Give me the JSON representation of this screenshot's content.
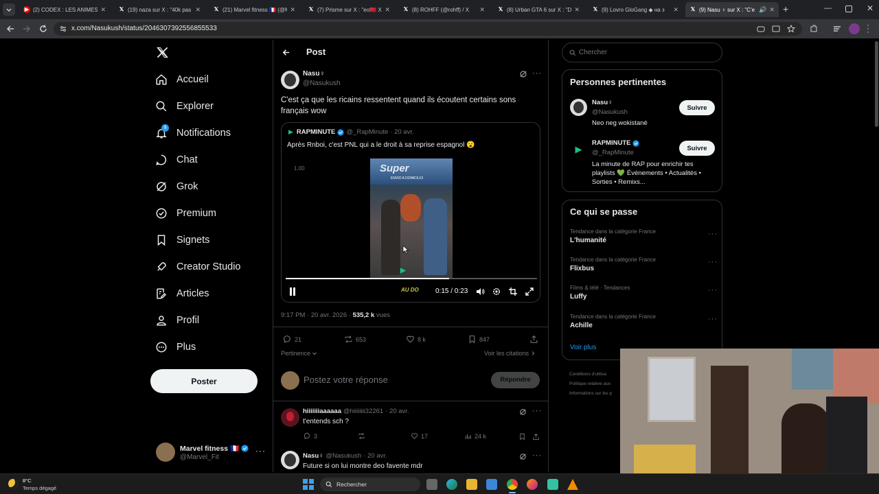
{
  "browser": {
    "tabs": [
      {
        "title": "(2) CODEX : LES ANIMES",
        "favicon_color": "#ff0000"
      },
      {
        "title": "(19) naza sur X : \"40k pas",
        "favicon_color": "#ffffff"
      },
      {
        "title": "(21) Marvel fitness 🇫🇷 (@M",
        "favicon_color": "#ffffff"
      },
      {
        "title": "(7) Prisme sur X : \"eo🇲🇦 X",
        "favicon_color": "#ffffff"
      },
      {
        "title": "(8) ROHFF (@rohff) / X",
        "favicon_color": "#ffffff"
      },
      {
        "title": "(8) Urban GTA 6 sur X : \"D",
        "favicon_color": "#ffffff"
      },
      {
        "title": "(9) Lovro GloGang ◆ на з",
        "favicon_color": "#ffffff"
      },
      {
        "title": "(9) Nasu ♀ sur X : \"C'e",
        "favicon_color": "#ffffff",
        "active": true
      }
    ],
    "url": "x.com/Nasukush/status/2046307392556855533"
  },
  "nav": {
    "items": [
      {
        "label": "Accueil",
        "icon": "home-icon"
      },
      {
        "label": "Explorer",
        "icon": "search-icon"
      },
      {
        "label": "Notifications",
        "icon": "bell-icon",
        "badge": "9"
      },
      {
        "label": "Chat",
        "icon": "chat-icon"
      },
      {
        "label": "Grok",
        "icon": "grok-icon"
      },
      {
        "label": "Premium",
        "icon": "premium-icon"
      },
      {
        "label": "Signets",
        "icon": "bookmark-icon"
      },
      {
        "label": "Creator Studio",
        "icon": "rocket-icon"
      },
      {
        "label": "Articles",
        "icon": "articles-icon"
      },
      {
        "label": "Profil",
        "icon": "person-icon"
      },
      {
        "label": "Plus",
        "icon": "more-circle-icon"
      }
    ],
    "post_button": "Poster",
    "account": {
      "name": "Marvel fitness 🇫🇷",
      "handle": "@Marvel_Fit"
    }
  },
  "post": {
    "header_title": "Post",
    "author": {
      "name": "Nasu♀",
      "handle": "@Nasukush"
    },
    "text": "C'est ça que les ricains ressentent quand ils écoutent certains sons français wow",
    "quote": {
      "name": "RAPMINUTE",
      "handle": "@_RapMinute",
      "age": "· 20 avr.",
      "text": "Après Rnboi, c'est PNL qui a le droit à sa reprise espagnol 😮",
      "video": {
        "overlay_speed": "1.00",
        "time": "0:15 / 0:23",
        "progress": 0.65,
        "sign_text": "Super",
        "sign_sub": "ENVIO A DOMICILIO",
        "watermark": "AU DO"
      }
    },
    "meta_time": "9:17 PM · 20 avr. 2026 · ",
    "meta_views": "535,2 k",
    "meta_views_label": " vues",
    "stats": {
      "replies": "21",
      "reposts": "653",
      "likes": "8 k",
      "bookmarks": "847"
    },
    "sort_label": "Pertinence",
    "quotes_link": "Voir les citations",
    "reply_placeholder": "Postez votre réponse",
    "reply_button": "Répondre"
  },
  "replies": [
    {
      "name": "hiiiiiiiaaaaaa",
      "handle": "@hiiiiiiii32261",
      "age": "· 20 avr.",
      "text": "t'entends sch ?",
      "stats": {
        "replies": "3",
        "reposts": "",
        "likes": "17",
        "views": "24 k"
      }
    },
    {
      "name": "Nasu♀",
      "handle": "@Nasukush",
      "age": "· 20 avr.",
      "text": "Future si on lui montre deo favente mdr"
    }
  ],
  "right": {
    "search_placeholder": "Chercher",
    "people_title": "Personnes pertinentes",
    "people": [
      {
        "name": "Nasu♀",
        "handle": "@Nasukush",
        "bio": "Neo neg wokistané",
        "follow": "Suivre"
      },
      {
        "name": "RAPMINUTE",
        "handle": "@_RapMinute",
        "bio": "La minute de RAP pour enrichir tes playlists 💚 Événements • Actualités • Sorties • Remixs...",
        "follow": "Suivre"
      }
    ],
    "trends_title": "Ce qui se passe",
    "trends": [
      {
        "category": "Tendance dans la catégorie France",
        "name": "L'humanité"
      },
      {
        "category": "Tendance dans la catégorie France",
        "name": "Flixbus"
      },
      {
        "category": "Films & télé · Tendances",
        "name": "Luffy"
      },
      {
        "category": "Tendance dans la catégorie France",
        "name": "Achille"
      }
    ],
    "show_more": "Voir plus",
    "footer_links": [
      "Conditions d'utilisa",
      "Politique relative aux",
      "Informations sur les p"
    ]
  },
  "taskbar": {
    "weather_temp": "8°C",
    "weather_desc": "Temps dégagé",
    "search_placeholder": "Rechercher"
  },
  "colors": {
    "accent": "#1d9bf0",
    "verified": "#1d9bf0",
    "post_button_bg": "#eff3f4",
    "background": "#000000",
    "border": "#2f3336"
  }
}
